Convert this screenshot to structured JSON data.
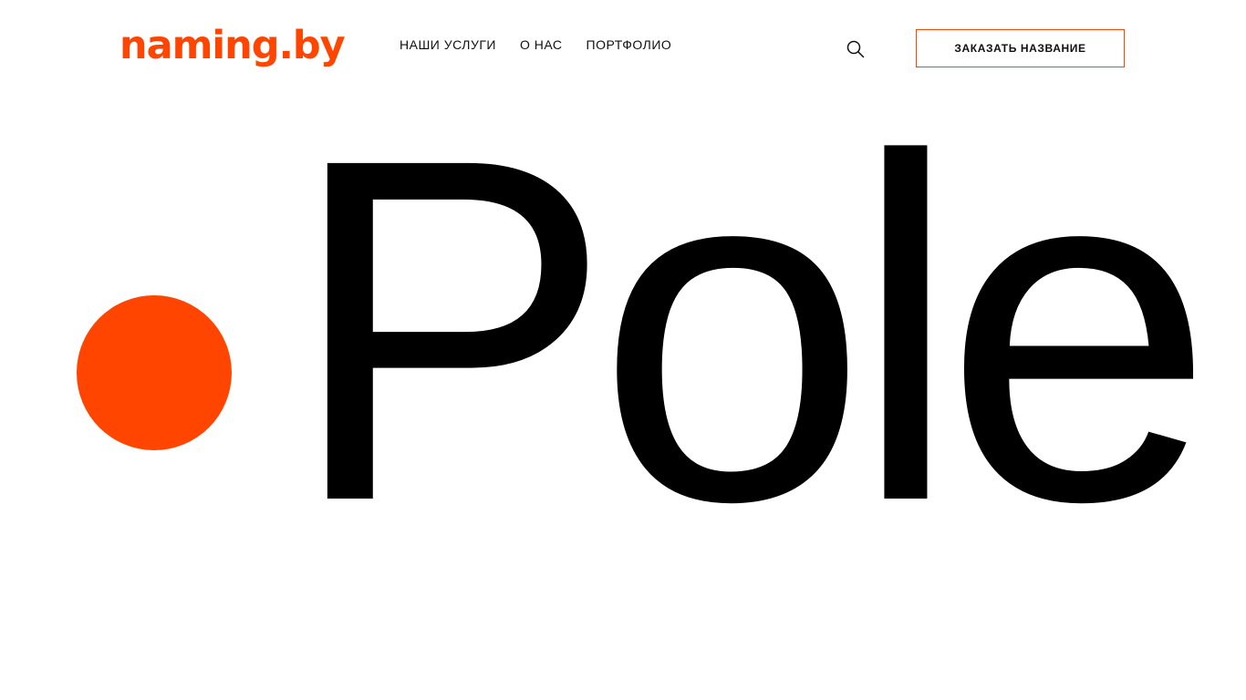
{
  "colors": {
    "accent": "#FF4500",
    "text": "#111111",
    "background": "#FFFFFF"
  },
  "header": {
    "logo_text": "naming.by",
    "nav": [
      {
        "label": "НАШИ УСЛУГИ"
      },
      {
        "label": "О НАС"
      },
      {
        "label": "ПОРТФОЛИО"
      }
    ],
    "search_icon": "search-icon",
    "order_button_label": "ЗАКАЗАТЬ НАЗВАНИЕ"
  },
  "hero": {
    "word": "Pole"
  }
}
